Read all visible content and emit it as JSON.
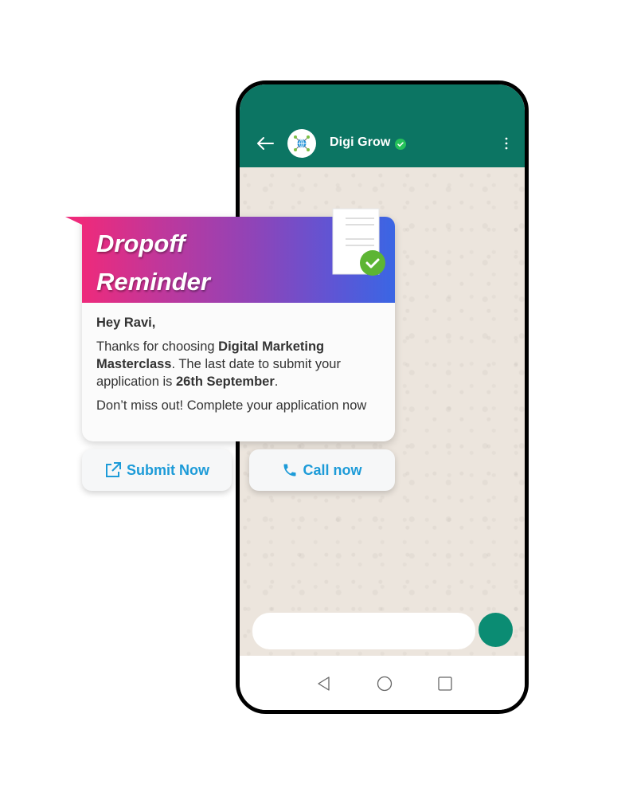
{
  "chat_header": {
    "contact_name": "Digi Grow",
    "verified": true,
    "icons": {
      "back": "arrow-left-icon",
      "avatar": "globe-network-logo",
      "verified": "verified-check-icon",
      "menu": "more-vertical-icon"
    }
  },
  "card": {
    "banner_title_line1": "Dropoff",
    "banner_title_line2": "Reminder",
    "greeting": "Hey Ravi,",
    "body1_pre": "Thanks for choosing ",
    "body1_bold": "Digital Marketing Masterclass",
    "body1_mid": ". The last date to submit your application is ",
    "body1_date": "26th September",
    "body1_end": ".",
    "body2": "Don’t miss out! Complete your application now",
    "icon": "document-check-icon"
  },
  "buttons": {
    "submit_label": "Submit Now",
    "submit_icon": "external-link-icon",
    "call_label": "Call now",
    "call_icon": "phone-icon"
  },
  "composer": {
    "input_value": "",
    "send_icon": "send-button"
  },
  "nav_bar": {
    "back": "triangle-back-icon",
    "home": "circle-home-icon",
    "recents": "square-recents-icon"
  },
  "colors": {
    "header_green": "#0c7563",
    "send_green": "#0b8c73",
    "gradient_start": "#ee2a7b",
    "gradient_end": "#3a66e4",
    "cta_blue": "#1d9bd8",
    "verified_green": "#25c25a"
  }
}
